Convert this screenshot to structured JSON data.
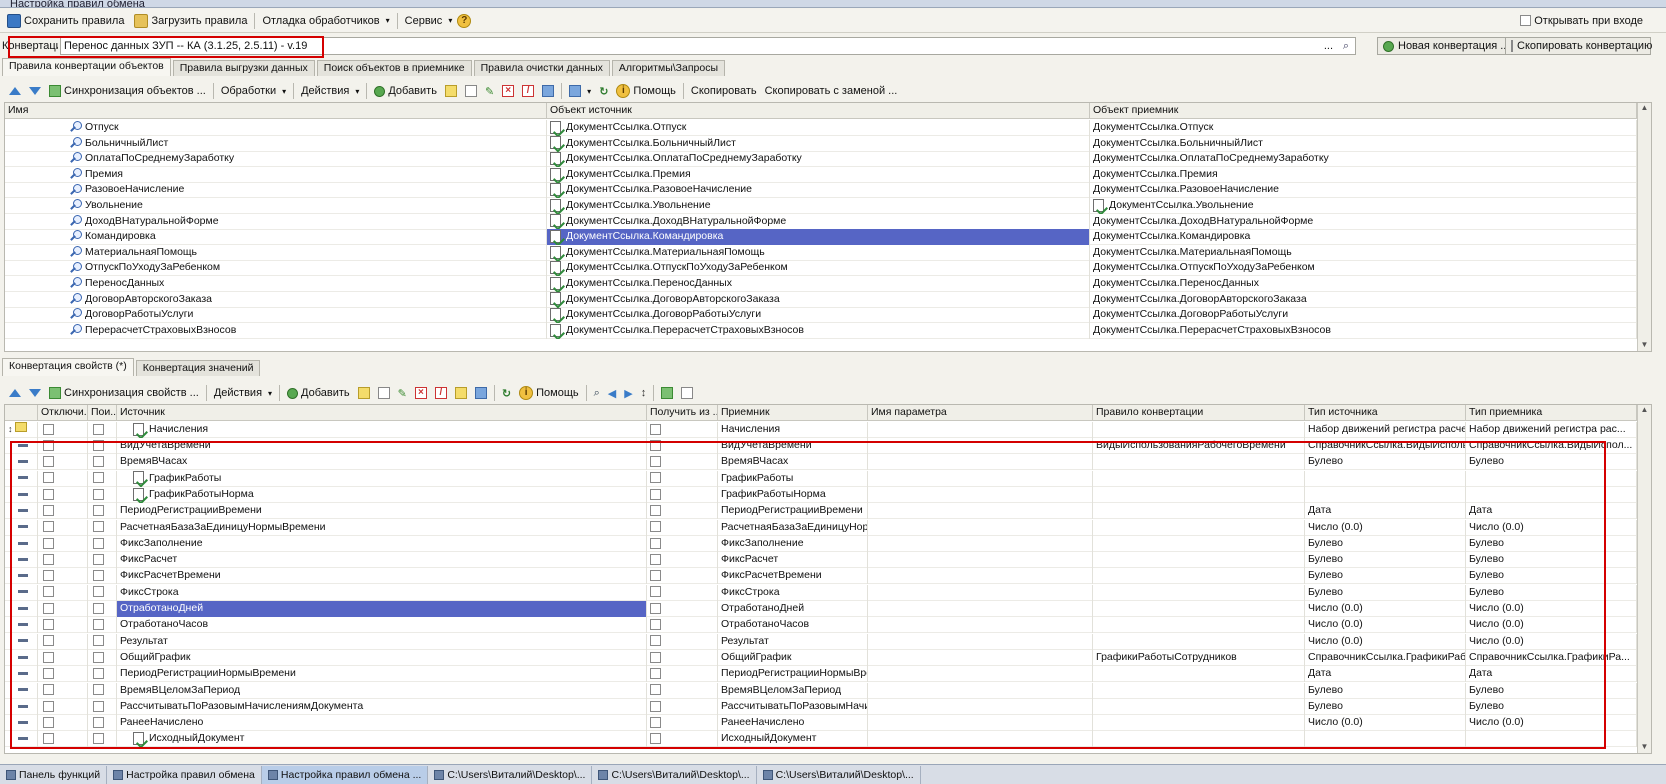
{
  "window": {
    "title": "Настройка правил обмена"
  },
  "menubar": {
    "save_label": "Сохранить правила",
    "load_label": "Загрузить правила",
    "debug_label": "Отладка обработчиков",
    "service_label": "Сервис",
    "open_on_start_label": "Открывать при входе"
  },
  "conversion": {
    "label": "Конвертация:",
    "value": "Перенос данных ЗУП -- КА (3.1.25, 2.5.11) - v.19",
    "select_symbol": "...",
    "new_label": "Новая конвертация ...",
    "copy_label": "Скопировать конвертацию"
  },
  "top_tabs": [
    "Правила конвертации объектов",
    "Правила выгрузки данных",
    "Поиск объектов в приемнике",
    "Правила очистки данных",
    "Алгоритмы\\Запросы"
  ],
  "top_toolbar": {
    "sync_label": "Синхронизация объектов ...",
    "handlers_label": "Обработки",
    "actions_label": "Действия",
    "add_label": "Добавить",
    "help_label": "Помощь",
    "copy_label": "Скопировать",
    "copy_replace_label": "Скопировать с заменой ..."
  },
  "top_grid": {
    "columns": [
      "Имя",
      "Объект источник",
      "Объект приемник"
    ],
    "rows": [
      [
        "Отпуск",
        "ДокументСсылка.Отпуск",
        "ДокументСсылка.Отпуск"
      ],
      [
        "БольничныйЛист",
        "ДокументСсылка.БольничныйЛист",
        "ДокументСсылка.БольничныйЛист"
      ],
      [
        "ОплатаПоСреднемуЗаработку",
        "ДокументСсылка.ОплатаПоСреднемуЗаработку",
        "ДокументСсылка.ОплатаПоСреднемуЗаработку"
      ],
      [
        "Премия",
        "ДокументСсылка.Премия",
        "ДокументСсылка.Премия"
      ],
      [
        "РазовоеНачисление",
        "ДокументСсылка.РазовоеНачисление",
        "ДокументСсылка.РазовоеНачисление"
      ],
      [
        "Увольнение",
        "ДокументСсылка.Увольнение",
        "ДокументСсылка.Увольнение"
      ],
      [
        "ДоходВНатуральнойФорме",
        "ДокументСсылка.ДоходВНатуральнойФорме",
        "ДокументСсылка.ДоходВНатуральнойФорме"
      ],
      [
        "Командировка",
        "ДокументСсылка.Командировка",
        "ДокументСсылка.Командировка"
      ],
      [
        "МатериальнаяПомощь",
        "ДокументСсылка.МатериальнаяПомощь",
        "ДокументСсылка.МатериальнаяПомощь"
      ],
      [
        "ОтпускПоУходуЗаРебенком",
        "ДокументСсылка.ОтпускПоУходуЗаРебенком",
        "ДокументСсылка.ОтпускПоУходуЗаРебенком"
      ],
      [
        "ПереносДанных",
        "ДокументСсылка.ПереносДанных",
        "ДокументСсылка.ПереносДанных"
      ],
      [
        "ДоговорАвторскогоЗаказа",
        "ДокументСсылка.ДоговорАвторскогоЗаказа",
        "ДокументСсылка.ДоговорАвторскогоЗаказа"
      ],
      [
        "ДоговорРаботыУслуги",
        "ДокументСсылка.ДоговорРаботыУслуги",
        "ДокументСсылка.ДоговорРаботыУслуги"
      ],
      [
        "ПерерасчетСтраховыхВзносов",
        "ДокументСсылка.ПерерасчетСтраховыхВзносов",
        "ДокументСсылка.ПерерасчетСтраховыхВзносов"
      ]
    ],
    "selected_row": 7
  },
  "bottom_tabs": [
    "Конвертация свойств (*)",
    "Конвертация значений"
  ],
  "bottom_toolbar": {
    "sync_label": "Синхронизация свойств ...",
    "actions_label": "Действия",
    "add_label": "Добавить",
    "help_label": "Помощь"
  },
  "bottom_grid": {
    "columns": [
      "Отключи...",
      "Пои...",
      "Источник",
      "Получить из ...",
      "Приемник",
      "Имя параметра",
      "Правило конвертации",
      "Тип источника",
      "Тип приемника"
    ],
    "group_row": {
      "source": "Начисления",
      "target": "Начисления",
      "src_type": "Набор движений регистра расчета",
      "dst_type": "Набор движений регистра рас..."
    },
    "rows": [
      [
        "ВидУчетаВремени",
        "ВидУчетаВремени",
        "ВидыИспользованияРабочегоВремени",
        "СправочникСсылка.ВидыИспольз...",
        "СправочникСсылка.ВидыИспол..."
      ],
      [
        "ВремяВЧасах",
        "ВремяВЧасах",
        "",
        "Булево",
        "Булево"
      ],
      [
        "ГрафикРаботы",
        "ГрафикРаботы",
        "",
        "",
        ""
      ],
      [
        "ГрафикРаботыНорма",
        "ГрафикРаботыНорма",
        "",
        "",
        ""
      ],
      [
        "ПериодРегистрацииВремени",
        "ПериодРегистрацииВремени",
        "",
        "Дата",
        "Дата"
      ],
      [
        "РасчетнаяБазаЗаЕдиницуНормыВремени",
        "РасчетнаяБазаЗаЕдиницуНор...",
        "",
        "Число (0.0)",
        "Число (0.0)"
      ],
      [
        "ФиксЗаполнение",
        "ФиксЗаполнение",
        "",
        "Булево",
        "Булево"
      ],
      [
        "ФиксРасчет",
        "ФиксРасчет",
        "",
        "Булево",
        "Булево"
      ],
      [
        "ФиксРасчетВремени",
        "ФиксРасчетВремени",
        "",
        "Булево",
        "Булево"
      ],
      [
        "ФиксСтрока",
        "ФиксСтрока",
        "",
        "Булево",
        "Булево"
      ],
      [
        "ОтработаноДней",
        "ОтработаноДней",
        "",
        "Число (0.0)",
        "Число (0.0)"
      ],
      [
        "ОтработаноЧасов",
        "ОтработаноЧасов",
        "",
        "Число (0.0)",
        "Число (0.0)"
      ],
      [
        "Результат",
        "Результат",
        "",
        "Число (0.0)",
        "Число (0.0)"
      ],
      [
        "ОбщийГрафик",
        "ОбщийГрафик",
        "ГрафикиРаботыСотрудников",
        "СправочникСсылка.ГрафикиРабо...",
        "СправочникСсылка.ГрафикиРа..."
      ],
      [
        "ПериодРегистрацииНормыВремени",
        "ПериодРегистрацииНормыВре...",
        "",
        "Дата",
        "Дата"
      ],
      [
        "ВремяВЦеломЗаПериод",
        "ВремяВЦеломЗаПериод",
        "",
        "Булево",
        "Булево"
      ],
      [
        "РассчитыватьПоРазовымНачислениямДокумента",
        "РассчитыватьПоРазовымНачи...",
        "",
        "Булево",
        "Булево"
      ],
      [
        "РанееНачислено",
        "РанееНачислено",
        "",
        "Число (0.0)",
        "Число (0.0)"
      ],
      [
        "ИсходныйДокумент",
        "ИсходныйДокумент",
        "",
        "",
        ""
      ]
    ],
    "doc_icon_rows": [
      2,
      3,
      18
    ],
    "selected_row": 10
  },
  "taskbar": [
    "Панель функций",
    "Настройка правил обмена",
    "Настройка правил обмена ...",
    "C:\\Users\\Виталий\\Desktop\\...",
    "C:\\Users\\Виталий\\Desktop\\...",
    "C:\\Users\\Виталий\\Desktop\\..."
  ],
  "colors": {
    "selection": "#5665c5",
    "highlight_box": "#d40000"
  }
}
